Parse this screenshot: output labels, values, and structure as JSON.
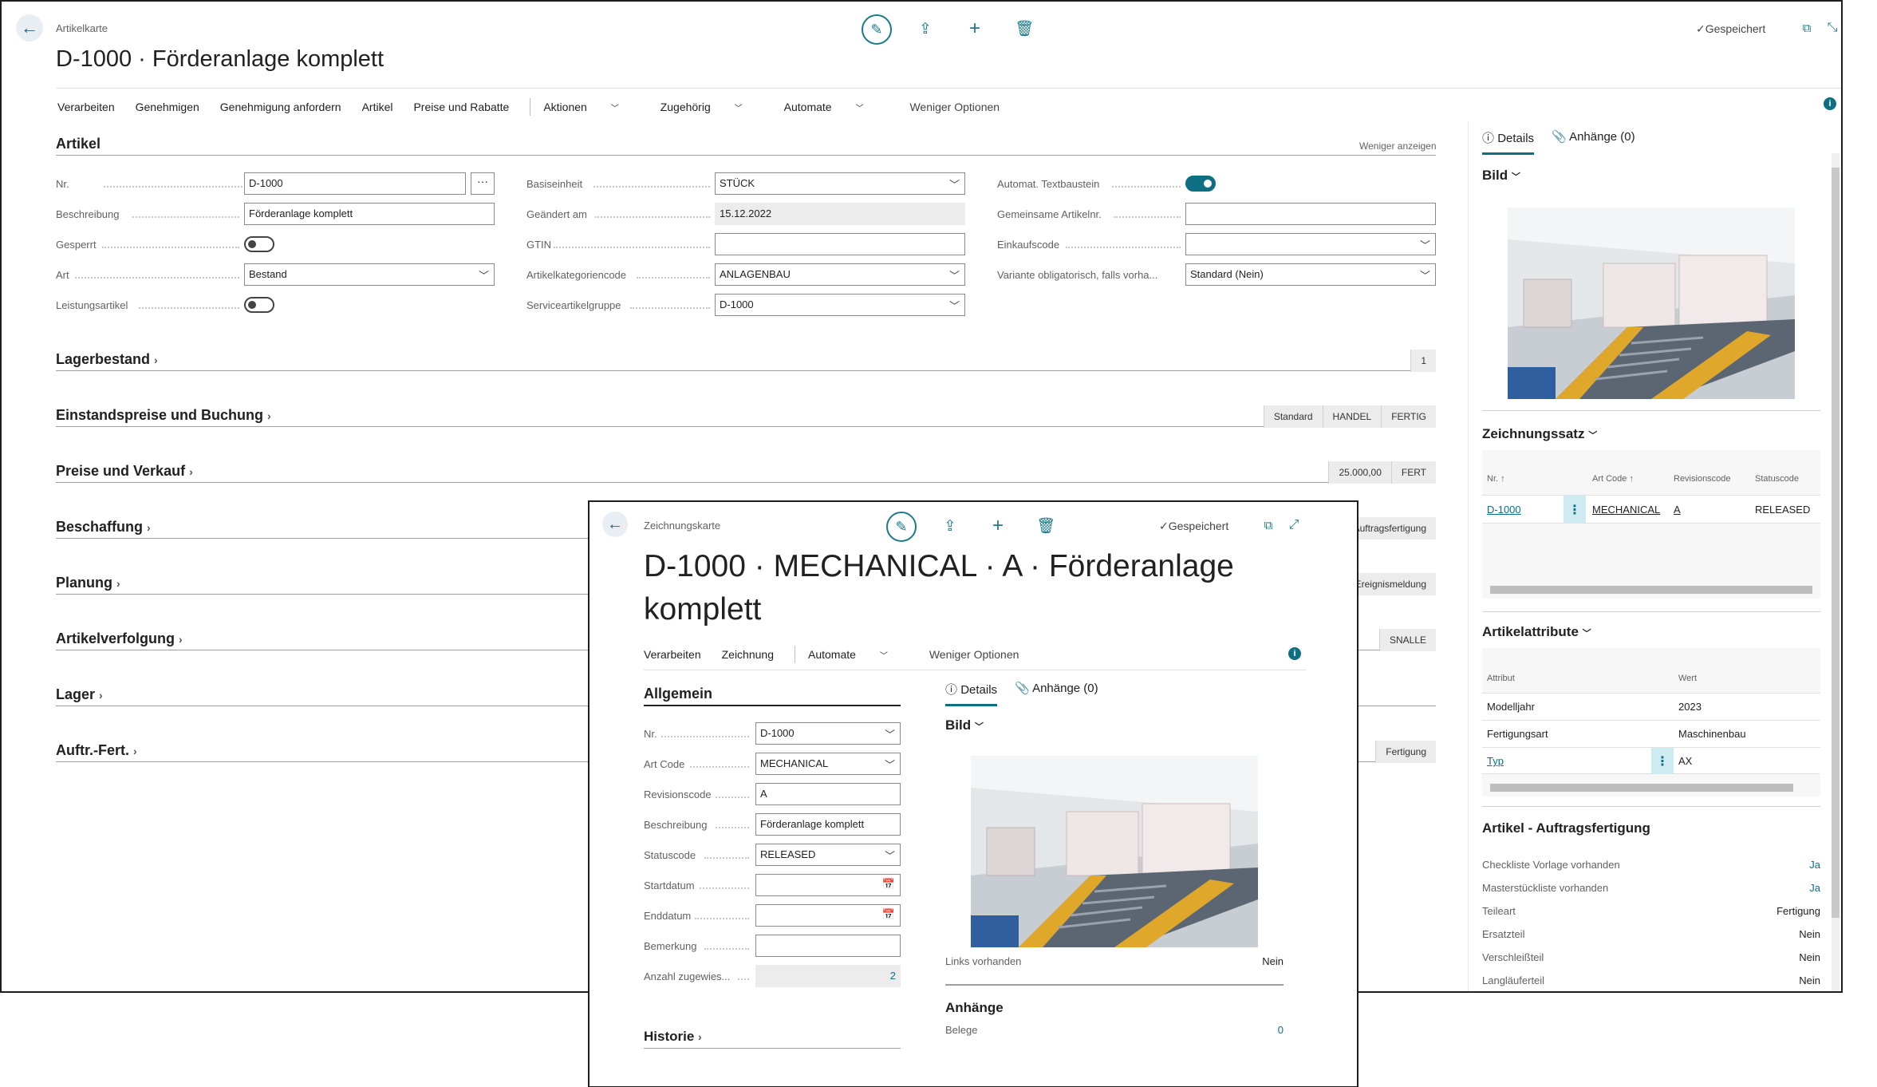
{
  "main": {
    "breadcrumb": "Artikelkarte",
    "title": "D-1000 · Förderanlage komplett",
    "saved": "Gespeichert",
    "menu": [
      "Verarbeiten",
      "Genehmigen",
      "Genehmigung anfordern",
      "Artikel",
      "Preise und Rabatte"
    ],
    "menu2": [
      "Aktionen",
      "Zugehörig",
      "Automate"
    ],
    "less_options": "Weniger Optionen",
    "section_artikel": "Artikel",
    "show_less": "Weniger anzeigen",
    "fields_col1": [
      {
        "label": "Nr.",
        "value": "D-1000"
      },
      {
        "label": "Beschreibung",
        "value": "Förderanlage komplett"
      },
      {
        "label": "Gesperrt",
        "value": ""
      },
      {
        "label": "Art",
        "value": "Bestand"
      },
      {
        "label": "Leistungsartikel",
        "value": ""
      }
    ],
    "fields_col2": [
      {
        "label": "Basiseinheit",
        "value": "STÜCK"
      },
      {
        "label": "Geändert am",
        "value": "15.12.2022"
      },
      {
        "label": "GTIN",
        "value": ""
      },
      {
        "label": "Artikelkategoriencode",
        "value": "ANLAGENBAU"
      },
      {
        "label": "Serviceartikelgruppe",
        "value": "D-1000"
      }
    ],
    "fields_col3": [
      {
        "label": "Automat. Textbaustein",
        "value": ""
      },
      {
        "label": "Gemeinsame Artikelnr.",
        "value": ""
      },
      {
        "label": "Einkaufscode",
        "value": ""
      },
      {
        "label": "Variante obligatorisch, falls vorha...",
        "value": "Standard (Nein)"
      }
    ],
    "sections": [
      {
        "title": "Lagerbestand",
        "badges": [
          "1"
        ]
      },
      {
        "title": "Einstandspreise und Buchung",
        "badges": [
          "Standard",
          "HANDEL",
          "FERTIG"
        ]
      },
      {
        "title": "Preise und Verkauf",
        "badges": [
          "25.000,00",
          "FERT"
        ]
      },
      {
        "title": "Beschaffung",
        "badges": [
          "Auftragsfertigung"
        ]
      },
      {
        "title": "Planung",
        "badges": [
          "Ereignismeldung"
        ]
      },
      {
        "title": "Artikelverfolgung",
        "badges": [
          "SNALLE"
        ]
      },
      {
        "title": "Lager",
        "badges": []
      },
      {
        "title": "Auftr.-Fert.",
        "badges": [
          "Fertigung"
        ]
      }
    ]
  },
  "factbox": {
    "tab_details": "Details",
    "tab_attachments": "Anhänge (0)",
    "bild": "Bild",
    "zeichnungssatz": "Zeichnungssatz",
    "zs_headers": [
      "Nr. ↑",
      "Art Code ↑",
      "Revisionscode",
      "Statuscode"
    ],
    "zs_row": [
      "D-1000",
      "MECHANICAL",
      "A",
      "RELEASED"
    ],
    "attr_title": "Artikelattribute",
    "attr_headers": [
      "Attribut",
      "Wert"
    ],
    "attr_rows": [
      [
        "Modelljahr",
        "2023"
      ],
      [
        "Fertigungsart",
        "Maschinenbau"
      ],
      [
        "Typ",
        "AX"
      ]
    ],
    "af_title": "Artikel - Auftragsfertigung",
    "af_rows": [
      [
        "Checkliste Vorlage vorhanden",
        "Ja"
      ],
      [
        "Masterstückliste vorhanden",
        "Ja"
      ],
      [
        "Teileart",
        "Fertigung"
      ],
      [
        "Ersatzteil",
        "Nein"
      ],
      [
        "Verschleißteil",
        "Nein"
      ],
      [
        "Langläuferteil",
        "Nein"
      ]
    ]
  },
  "popup": {
    "breadcrumb": "Zeichnungskarte",
    "saved": "Gespeichert",
    "title_line1": "D-1000 · MECHANICAL · A · Förderanlage",
    "title_line2": "komplett",
    "menu": [
      "Verarbeiten",
      "Zeichnung"
    ],
    "automate": "Automate",
    "less_options": "Weniger Optionen",
    "section": "Allgemein",
    "fields": [
      {
        "label": "Nr.",
        "value": "D-1000"
      },
      {
        "label": "Art Code",
        "value": "MECHANICAL"
      },
      {
        "label": "Revisionscode",
        "value": "A"
      },
      {
        "label": "Beschreibung",
        "value": "Förderanlage komplett"
      },
      {
        "label": "Statuscode",
        "value": "RELEASED"
      },
      {
        "label": "Startdatum",
        "value": ""
      },
      {
        "label": "Enddatum",
        "value": ""
      },
      {
        "label": "Bemerkung",
        "value": ""
      },
      {
        "label": "Anzahl zugewies...",
        "value": "2"
      }
    ],
    "historie": "Historie",
    "tab_details": "Details",
    "tab_attachments": "Anhänge (0)",
    "bild": "Bild",
    "links_label": "Links vorhanden",
    "links_value": "Nein",
    "anhaenge": "Anhänge",
    "belege_label": "Belege",
    "belege_value": "0"
  },
  "colors": {
    "accent": "#0e6e82",
    "link": "#0b6f8a"
  }
}
